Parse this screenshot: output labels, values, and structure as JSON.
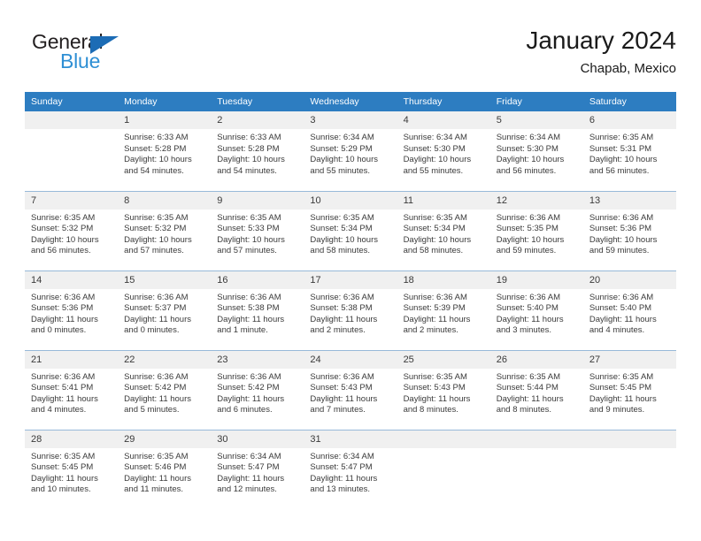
{
  "brand": {
    "word_one": "General",
    "word_two": "Blue",
    "triangle_color": "#1c6cb5",
    "blue_color": "#2e8fd4"
  },
  "header": {
    "title": "January 2024",
    "subtitle": "Chapab, Mexico"
  },
  "theme": {
    "header_row_bg": "#2d7dc1",
    "daynum_bg": "#f0f0f0",
    "grid_line": "#97b9d9",
    "text": "#3a3a3a"
  },
  "weekday_headers": [
    "Sunday",
    "Monday",
    "Tuesday",
    "Wednesday",
    "Thursday",
    "Friday",
    "Saturday"
  ],
  "weeks": [
    [
      {
        "day": "",
        "sunrise": "",
        "sunset": "",
        "daylight_line1": "",
        "daylight_line2": ""
      },
      {
        "day": "1",
        "sunrise": "Sunrise: 6:33 AM",
        "sunset": "Sunset: 5:28 PM",
        "daylight_line1": "Daylight: 10 hours",
        "daylight_line2": "and 54 minutes."
      },
      {
        "day": "2",
        "sunrise": "Sunrise: 6:33 AM",
        "sunset": "Sunset: 5:28 PM",
        "daylight_line1": "Daylight: 10 hours",
        "daylight_line2": "and 54 minutes."
      },
      {
        "day": "3",
        "sunrise": "Sunrise: 6:34 AM",
        "sunset": "Sunset: 5:29 PM",
        "daylight_line1": "Daylight: 10 hours",
        "daylight_line2": "and 55 minutes."
      },
      {
        "day": "4",
        "sunrise": "Sunrise: 6:34 AM",
        "sunset": "Sunset: 5:30 PM",
        "daylight_line1": "Daylight: 10 hours",
        "daylight_line2": "and 55 minutes."
      },
      {
        "day": "5",
        "sunrise": "Sunrise: 6:34 AM",
        "sunset": "Sunset: 5:30 PM",
        "daylight_line1": "Daylight: 10 hours",
        "daylight_line2": "and 56 minutes."
      },
      {
        "day": "6",
        "sunrise": "Sunrise: 6:35 AM",
        "sunset": "Sunset: 5:31 PM",
        "daylight_line1": "Daylight: 10 hours",
        "daylight_line2": "and 56 minutes."
      }
    ],
    [
      {
        "day": "7",
        "sunrise": "Sunrise: 6:35 AM",
        "sunset": "Sunset: 5:32 PM",
        "daylight_line1": "Daylight: 10 hours",
        "daylight_line2": "and 56 minutes."
      },
      {
        "day": "8",
        "sunrise": "Sunrise: 6:35 AM",
        "sunset": "Sunset: 5:32 PM",
        "daylight_line1": "Daylight: 10 hours",
        "daylight_line2": "and 57 minutes."
      },
      {
        "day": "9",
        "sunrise": "Sunrise: 6:35 AM",
        "sunset": "Sunset: 5:33 PM",
        "daylight_line1": "Daylight: 10 hours",
        "daylight_line2": "and 57 minutes."
      },
      {
        "day": "10",
        "sunrise": "Sunrise: 6:35 AM",
        "sunset": "Sunset: 5:34 PM",
        "daylight_line1": "Daylight: 10 hours",
        "daylight_line2": "and 58 minutes."
      },
      {
        "day": "11",
        "sunrise": "Sunrise: 6:35 AM",
        "sunset": "Sunset: 5:34 PM",
        "daylight_line1": "Daylight: 10 hours",
        "daylight_line2": "and 58 minutes."
      },
      {
        "day": "12",
        "sunrise": "Sunrise: 6:36 AM",
        "sunset": "Sunset: 5:35 PM",
        "daylight_line1": "Daylight: 10 hours",
        "daylight_line2": "and 59 minutes."
      },
      {
        "day": "13",
        "sunrise": "Sunrise: 6:36 AM",
        "sunset": "Sunset: 5:36 PM",
        "daylight_line1": "Daylight: 10 hours",
        "daylight_line2": "and 59 minutes."
      }
    ],
    [
      {
        "day": "14",
        "sunrise": "Sunrise: 6:36 AM",
        "sunset": "Sunset: 5:36 PM",
        "daylight_line1": "Daylight: 11 hours",
        "daylight_line2": "and 0 minutes."
      },
      {
        "day": "15",
        "sunrise": "Sunrise: 6:36 AM",
        "sunset": "Sunset: 5:37 PM",
        "daylight_line1": "Daylight: 11 hours",
        "daylight_line2": "and 0 minutes."
      },
      {
        "day": "16",
        "sunrise": "Sunrise: 6:36 AM",
        "sunset": "Sunset: 5:38 PM",
        "daylight_line1": "Daylight: 11 hours",
        "daylight_line2": "and 1 minute."
      },
      {
        "day": "17",
        "sunrise": "Sunrise: 6:36 AM",
        "sunset": "Sunset: 5:38 PM",
        "daylight_line1": "Daylight: 11 hours",
        "daylight_line2": "and 2 minutes."
      },
      {
        "day": "18",
        "sunrise": "Sunrise: 6:36 AM",
        "sunset": "Sunset: 5:39 PM",
        "daylight_line1": "Daylight: 11 hours",
        "daylight_line2": "and 2 minutes."
      },
      {
        "day": "19",
        "sunrise": "Sunrise: 6:36 AM",
        "sunset": "Sunset: 5:40 PM",
        "daylight_line1": "Daylight: 11 hours",
        "daylight_line2": "and 3 minutes."
      },
      {
        "day": "20",
        "sunrise": "Sunrise: 6:36 AM",
        "sunset": "Sunset: 5:40 PM",
        "daylight_line1": "Daylight: 11 hours",
        "daylight_line2": "and 4 minutes."
      }
    ],
    [
      {
        "day": "21",
        "sunrise": "Sunrise: 6:36 AM",
        "sunset": "Sunset: 5:41 PM",
        "daylight_line1": "Daylight: 11 hours",
        "daylight_line2": "and 4 minutes."
      },
      {
        "day": "22",
        "sunrise": "Sunrise: 6:36 AM",
        "sunset": "Sunset: 5:42 PM",
        "daylight_line1": "Daylight: 11 hours",
        "daylight_line2": "and 5 minutes."
      },
      {
        "day": "23",
        "sunrise": "Sunrise: 6:36 AM",
        "sunset": "Sunset: 5:42 PM",
        "daylight_line1": "Daylight: 11 hours",
        "daylight_line2": "and 6 minutes."
      },
      {
        "day": "24",
        "sunrise": "Sunrise: 6:36 AM",
        "sunset": "Sunset: 5:43 PM",
        "daylight_line1": "Daylight: 11 hours",
        "daylight_line2": "and 7 minutes."
      },
      {
        "day": "25",
        "sunrise": "Sunrise: 6:35 AM",
        "sunset": "Sunset: 5:43 PM",
        "daylight_line1": "Daylight: 11 hours",
        "daylight_line2": "and 8 minutes."
      },
      {
        "day": "26",
        "sunrise": "Sunrise: 6:35 AM",
        "sunset": "Sunset: 5:44 PM",
        "daylight_line1": "Daylight: 11 hours",
        "daylight_line2": "and 8 minutes."
      },
      {
        "day": "27",
        "sunrise": "Sunrise: 6:35 AM",
        "sunset": "Sunset: 5:45 PM",
        "daylight_line1": "Daylight: 11 hours",
        "daylight_line2": "and 9 minutes."
      }
    ],
    [
      {
        "day": "28",
        "sunrise": "Sunrise: 6:35 AM",
        "sunset": "Sunset: 5:45 PM",
        "daylight_line1": "Daylight: 11 hours",
        "daylight_line2": "and 10 minutes."
      },
      {
        "day": "29",
        "sunrise": "Sunrise: 6:35 AM",
        "sunset": "Sunset: 5:46 PM",
        "daylight_line1": "Daylight: 11 hours",
        "daylight_line2": "and 11 minutes."
      },
      {
        "day": "30",
        "sunrise": "Sunrise: 6:34 AM",
        "sunset": "Sunset: 5:47 PM",
        "daylight_line1": "Daylight: 11 hours",
        "daylight_line2": "and 12 minutes."
      },
      {
        "day": "31",
        "sunrise": "Sunrise: 6:34 AM",
        "sunset": "Sunset: 5:47 PM",
        "daylight_line1": "Daylight: 11 hours",
        "daylight_line2": "and 13 minutes."
      },
      {
        "day": "",
        "sunrise": "",
        "sunset": "",
        "daylight_line1": "",
        "daylight_line2": ""
      },
      {
        "day": "",
        "sunrise": "",
        "sunset": "",
        "daylight_line1": "",
        "daylight_line2": ""
      },
      {
        "day": "",
        "sunrise": "",
        "sunset": "",
        "daylight_line1": "",
        "daylight_line2": ""
      }
    ]
  ]
}
